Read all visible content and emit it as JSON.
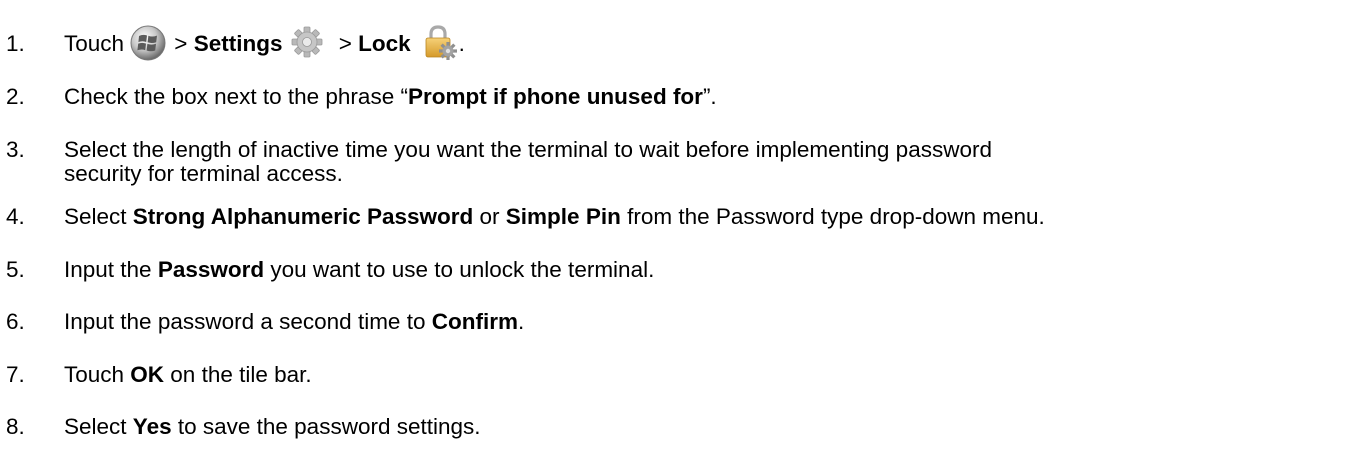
{
  "steps": [
    {
      "number": "1.",
      "touch": "Touch",
      "sep1": " > ",
      "settings": "Settings",
      "sep2": " > ",
      "lock": "Lock",
      "end": ".",
      "icons": [
        "windows-start-icon",
        "gear-icon",
        "lock-icon"
      ]
    },
    {
      "number": "2.",
      "pre": "Check the box next to the phrase “",
      "bold": "Prompt if phone unused for",
      "post": "”."
    },
    {
      "number": "3.",
      "line1": "Select the length of inactive time you want the terminal to wait before implementing password",
      "line2": "security for terminal access."
    },
    {
      "number": "4.",
      "pre": "Select ",
      "bold1": "Strong Alphanumeric Password",
      "mid": " or ",
      "bold2": "Simple Pin",
      "post": " from the Password type drop-down menu."
    },
    {
      "number": "5.",
      "pre": "Input the ",
      "bold": "Password",
      "post": " you want to use to unlock the terminal."
    },
    {
      "number": "6.",
      "pre": "Input the password a second time to ",
      "bold": "Confirm",
      "post": "."
    },
    {
      "number": "7.",
      "pre": "Touch ",
      "bold": "OK",
      "post": " on the tile bar."
    },
    {
      "number": "8.",
      "pre": "Select ",
      "bold": "Yes",
      "post": " to save the password settings."
    }
  ]
}
